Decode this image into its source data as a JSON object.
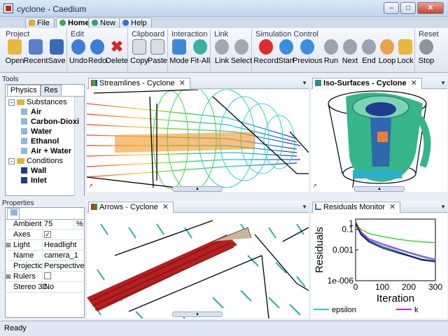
{
  "window": {
    "title": "cyclone - Caedium"
  },
  "ribbon_tabs": [
    {
      "label": "File",
      "color": "#e7a933"
    },
    {
      "label": "Home",
      "color": "#3aa84a"
    },
    {
      "label": "New",
      "color": "#2fa16c"
    },
    {
      "label": "Help",
      "color": "#3a6fd0"
    }
  ],
  "groups": {
    "project": {
      "title": "Project",
      "buttons": [
        "Open",
        "Recent",
        "Save"
      ]
    },
    "edit": {
      "title": "Edit",
      "buttons": [
        "Undo",
        "Redo",
        "Delete"
      ]
    },
    "clipboard": {
      "title": "Clipboard",
      "buttons": [
        "Copy",
        "Paste"
      ]
    },
    "interaction": {
      "title": "Interaction",
      "buttons": [
        "Mode",
        "Fit-All"
      ]
    },
    "link": {
      "title": "Link",
      "buttons": [
        "Link",
        "Select"
      ]
    },
    "simulation": {
      "title": "Simulation Control",
      "buttons": [
        "Record",
        "Start",
        "Previous",
        "Run",
        "Next",
        "End",
        "Loop",
        "Lock"
      ]
    },
    "reset": {
      "title": "Reset",
      "buttons": [
        "Stop"
      ]
    }
  },
  "tools": {
    "title": "Tools",
    "tabs": [
      "Physics",
      "Res"
    ],
    "tree": [
      {
        "label": "Substances",
        "level": 0,
        "type": "folder"
      },
      {
        "label": "Air",
        "level": 1,
        "type": "leaf",
        "color": "#8fb7e0"
      },
      {
        "label": "Carbon-Dioxi",
        "level": 1,
        "type": "leaf",
        "color": "#8fb7e0"
      },
      {
        "label": "Water",
        "level": 1,
        "type": "leaf",
        "color": "#8fb7e0"
      },
      {
        "label": "Ethanol",
        "level": 1,
        "type": "leaf",
        "color": "#8fb7e0"
      },
      {
        "label": "Air + Water",
        "level": 1,
        "type": "leaf",
        "color": "#8fb7e0"
      },
      {
        "label": "Conditions",
        "level": 0,
        "type": "folder"
      },
      {
        "label": "Wall",
        "level": 1,
        "type": "leaf",
        "color": "#1a3c8f"
      },
      {
        "label": "Inlet",
        "level": 1,
        "type": "leaf",
        "color": "#1a3c8f"
      }
    ]
  },
  "properties": {
    "title": "Properties",
    "rows": [
      {
        "key": "Ambient",
        "value": "75",
        "unit": "%"
      },
      {
        "key": "Axes",
        "value": "",
        "checkbox": true,
        "checked": true
      },
      {
        "key": "Light",
        "value": "Headlight",
        "expandable": true
      },
      {
        "key": "Name",
        "value": "camera_1"
      },
      {
        "key": "Projectio",
        "value": "Perspective"
      },
      {
        "key": "Rulers",
        "value": "",
        "checkbox": true,
        "checked": false,
        "expandable": true
      },
      {
        "key": "Stereo 3D",
        "value": "No"
      }
    ]
  },
  "views": {
    "streamlines": "Streamlines - Cyclone",
    "isosurfaces": "Iso-Surfaces - Cyclone",
    "arrows": "Arrows - Cyclone",
    "residuals": "Residuals Monitor"
  },
  "chart_data": {
    "type": "line",
    "ylabel": "Residuals",
    "xlabel": "Iteration",
    "xlim": [
      0,
      300
    ],
    "ylim": [
      1e-06,
      1
    ],
    "yscale": "log",
    "yticks": [
      "0.1",
      "0.001",
      "1e-006"
    ],
    "xticks": [
      "0",
      "100",
      "200",
      "300"
    ],
    "series": [
      {
        "name": "epsilon",
        "color": "#22c7d8",
        "x": [
          0,
          20,
          50,
          100,
          150,
          200,
          250,
          300
        ],
        "y": [
          0.5,
          0.05,
          0.01,
          0.003,
          0.0012,
          0.0005,
          0.0002,
          0.0001
        ]
      },
      {
        "name": "k",
        "color": "#d020c0",
        "x": [
          0,
          20,
          50,
          100,
          150,
          200,
          250,
          300
        ],
        "y": [
          0.6,
          0.06,
          0.012,
          0.004,
          0.0015,
          0.0006,
          0.00025,
          0.00012
        ]
      },
      {
        "color": "#2ad42a",
        "x": [
          0,
          20,
          50,
          100,
          150,
          200,
          250,
          300
        ],
        "y": [
          0.3,
          0.1,
          0.04,
          0.02,
          0.012,
          0.008,
          0.006,
          0.005
        ]
      },
      {
        "color": "#1a2ad0",
        "x": [
          0,
          20,
          50,
          100,
          150,
          200,
          250,
          300
        ],
        "y": [
          0.4,
          0.04,
          0.008,
          0.002,
          0.0008,
          0.0003,
          0.00012,
          8e-05
        ]
      },
      {
        "color": "#222222",
        "x": [
          0,
          20,
          50,
          100,
          150,
          200,
          250,
          300
        ],
        "y": [
          0.35,
          0.03,
          0.006,
          0.0015,
          0.0006,
          0.00025,
          0.0001,
          7e-05
        ]
      }
    ]
  },
  "status": {
    "text": "Ready"
  }
}
